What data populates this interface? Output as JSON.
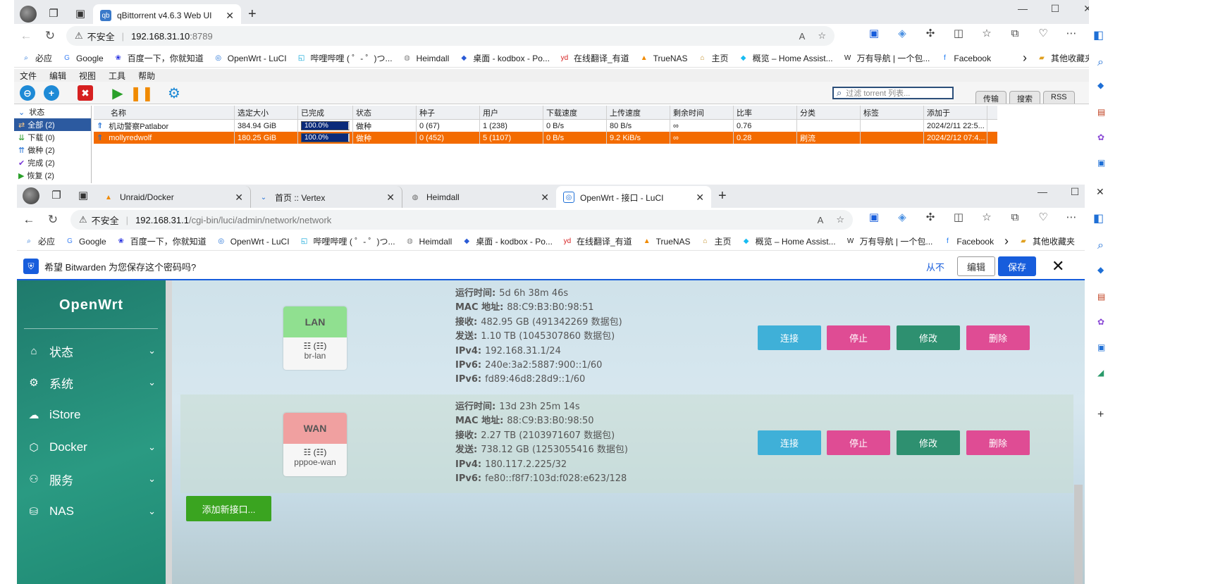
{
  "back_window": {
    "tab_title": "qBittorrent v4.6.3 Web UI",
    "url_warning": "不安全",
    "url_host": "192.168.31.10",
    "url_path": ":8789",
    "menu": [
      "文件",
      "编辑",
      "视图",
      "工具",
      "帮助"
    ],
    "filter_placeholder": "过滤 torrent 列表...",
    "view_tabs": [
      "传输",
      "搜索",
      "RSS"
    ],
    "sidebar": {
      "status_label": "状态",
      "items": [
        "全部 (2)",
        "下载 (0)",
        "做种 (2)",
        "完成 (2)",
        "恢复 (2)"
      ]
    },
    "columns": [
      "名称",
      "选定大小",
      "已完成",
      "状态",
      "种子",
      "用户",
      "下载速度",
      "上传速度",
      "剩余时间",
      "比率",
      "分类",
      "标签",
      "添加于"
    ],
    "rows": [
      {
        "name": "机动警察Patlabor",
        "size": "384.94 GiB",
        "progress": "100.0%",
        "status": "做种",
        "seeds": "0 (67)",
        "peers": "1 (238)",
        "dl": "0 B/s",
        "ul": "80 B/s",
        "eta": "∞",
        "ratio": "0.76",
        "category": "",
        "tags": "",
        "added": "2024/2/11 22:5..."
      },
      {
        "name": "mollyredwolf",
        "size": "180.25 GiB",
        "progress": "100.0%",
        "status": "做种",
        "seeds": "0 (452)",
        "peers": "5 (1107)",
        "dl": "0 B/s",
        "ul": "9.2 KiB/s",
        "eta": "∞",
        "ratio": "0.28",
        "category": "刷流",
        "tags": "",
        "added": "2024/2/12 07:4..."
      }
    ]
  },
  "bookmarks": [
    "必应",
    "Google",
    "百度一下，你就知道",
    "OpenWrt - LuCI",
    "哔哩哔哩 ( ゜- ゜)つ...",
    "Heimdall",
    "桌面 - kodbox - Po...",
    "在线翻译_有道",
    "TrueNAS",
    "主页",
    "概览 – Home Assist...",
    "万有导航 | 一个包...",
    "Facebook"
  ],
  "bookmarks_other": "其他收藏夹",
  "front_window": {
    "tabs": [
      "Unraid/Docker",
      "首页 :: Vertex",
      "Heimdall",
      "OpenWrt - 接口 - LuCI"
    ],
    "url_warning": "不安全",
    "url_host": "192.168.31.1",
    "url_path": "/cgi-bin/luci/admin/network/network",
    "bitwarden": {
      "message": "希望 Bitwarden 为您保存这个密码吗?",
      "never": "从不",
      "edit": "编辑",
      "save": "保存"
    }
  },
  "luci": {
    "logo": "OpenWrt",
    "nav": [
      "状态",
      "系统",
      "iStore",
      "Docker",
      "服务",
      "NAS"
    ],
    "interfaces": [
      {
        "name": "LAN",
        "header_color": "#90e090",
        "icons": "☷ (☷)",
        "device": "br-lan",
        "lines": [
          {
            "k": "运行时间:",
            "v": "5d 6h 38m 46s"
          },
          {
            "k": "MAC 地址:",
            "v": "88:C9:B3:B0:98:51"
          },
          {
            "k": "接收:",
            "v": "482.95 GB (491342269 数据包)"
          },
          {
            "k": "发送:",
            "v": "1.10 TB (1045307860 数据包)"
          },
          {
            "k": "IPv4:",
            "v": "192.168.31.1/24"
          },
          {
            "k": "IPv6:",
            "v": "240e:3a2:5887:900::1/60"
          },
          {
            "k": "IPv6:",
            "v": "fd89:46d8:28d9::1/60"
          }
        ]
      },
      {
        "name": "WAN",
        "header_color": "#f0a0a0",
        "icons": "☷ (☷)",
        "device": "pppoe-wan",
        "lines": [
          {
            "k": "运行时间:",
            "v": "13d 23h 25m 14s"
          },
          {
            "k": "MAC 地址:",
            "v": "88:C9:B3:B0:98:50"
          },
          {
            "k": "接收:",
            "v": "2.27 TB (2103971607 数据包)"
          },
          {
            "k": "发送:",
            "v": "738.12 GB (1253055416 数据包)"
          },
          {
            "k": "IPv4:",
            "v": "180.117.2.225/32"
          },
          {
            "k": "IPv6:",
            "v": "fe80::f8f7:103d:f028:e623/128"
          }
        ]
      }
    ],
    "buttons": {
      "connect": "连接",
      "stop": "停止",
      "edit": "修改",
      "delete": "删除"
    },
    "add_interface": "添加新接口..."
  }
}
